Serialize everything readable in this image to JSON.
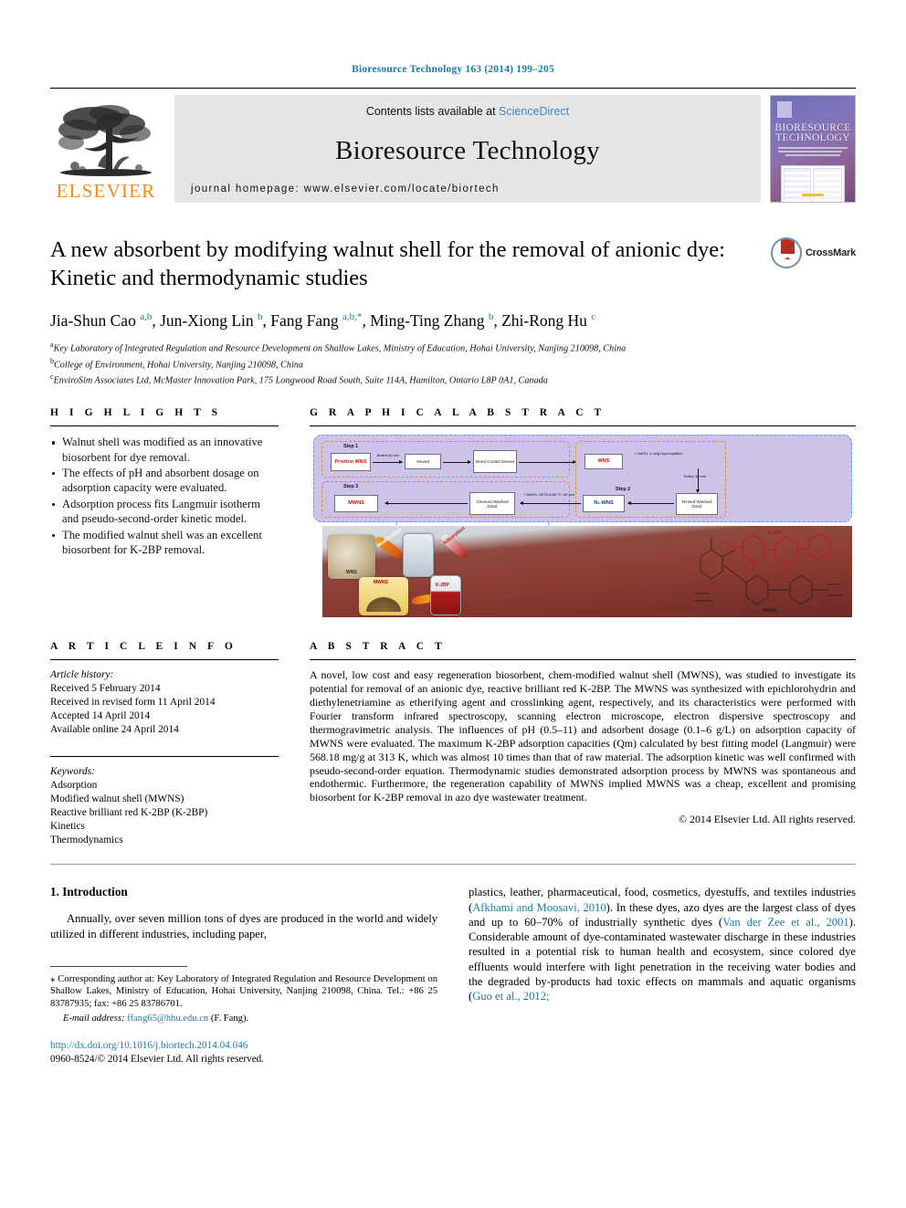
{
  "running_head": "Bioresource Technology 163 (2014) 199–205",
  "masthead": {
    "publisher": "ELSEVIER",
    "contents_prefix": "Contents lists available at ",
    "contents_link": "ScienceDirect",
    "journal_name": "Bioresource Technology",
    "homepage": "journal homepage: www.elsevier.com/locate/biortech",
    "cover_title_line1": "BIORESOURCE",
    "cover_title_line2": "TECHNOLOGY"
  },
  "article": {
    "title": "A new absorbent by modifying walnut shell for the removal of anionic dye: Kinetic and thermodynamic studies",
    "crossmark_label": "CrossMark",
    "authors": [
      {
        "name": "Jia-Shun Cao",
        "sup": "a,b"
      },
      {
        "name": "Jun-Xiong Lin",
        "sup": "b"
      },
      {
        "name": "Fang Fang",
        "sup": "a,b,*"
      },
      {
        "name": "Ming-Ting Zhang",
        "sup": "b"
      },
      {
        "name": "Zhi-Rong Hu",
        "sup": "c"
      }
    ],
    "affiliations": [
      {
        "marker": "a",
        "text": "Key Laboratory of Integrated Regulation and Resource Development on Shallow Lakes, Ministry of Education, Hohai University, Nanjing 210098, China"
      },
      {
        "marker": "b",
        "text": "College of Environment, Hohai University, Nanjing 210098, China"
      },
      {
        "marker": "c",
        "text": "EnviroSim Associates Ltd, McMaster Innovation Park, 175 Longwood Road South, Suite 114A, Hamilton, Ontario L8P 0A1, Canada"
      }
    ]
  },
  "highlights": {
    "label": "H I G H L I G H T S",
    "items": [
      "Walnut shell was modified as an innovative biosorbent for dye removal.",
      "The effects of pH and absorbent dosage on adsorption capacity were evaluated.",
      "Adsorption process fits Langmuir isotherm and pseudo-second-order kinetic model.",
      "The modified walnut shell was an excellent biosorbent for K-2BP removal."
    ]
  },
  "graphical_abstract": {
    "label": "G R A P H I C A L   A B S T R A C T",
    "flow": {
      "step1_label": "Step 1",
      "step2_label": "Step 2",
      "step3_label": "Step 3",
      "nodes": [
        {
          "id": "pristine",
          "text": "Pristine WNS",
          "style": "red"
        },
        {
          "id": "sieved",
          "text": "Sieved"
        },
        {
          "id": "dried1",
          "text": "Dried Cooled Sieved"
        },
        {
          "id": "wns",
          "text": "WNS",
          "style": "red"
        },
        {
          "id": "rinsed",
          "text": "Rinsed Washed Dried"
        },
        {
          "id": "n_wns",
          "text": "N₂-WNS",
          "style": "blue"
        },
        {
          "id": "cleaned",
          "text": "Cleaned Washed Dried"
        },
        {
          "id": "mwns",
          "text": "MWNS",
          "style": "red"
        }
      ],
      "annotations": [
        "Boiled 60 min",
        "+ NaOH, 4 ml/g Hydroxylation",
        "Reflux 30 min",
        "+ NaOH, DETA Δ 80 °C, 60 min"
      ]
    },
    "photo_labels": [
      "WNS",
      "MWNS",
      "K-2BP",
      "Modification",
      "Adsorption",
      "MWNS"
    ]
  },
  "article_info": {
    "label": "A R T I C L E   I N F O",
    "history_title": "Article history:",
    "history": [
      "Received 5 February 2014",
      "Received in revised form 11 April 2014",
      "Accepted 14 April 2014",
      "Available online 24 April 2014"
    ],
    "keywords_title": "Keywords:",
    "keywords": [
      "Adsorption",
      "Modified walnut shell (MWNS)",
      "Reactive brilliant red K-2BP (K-2BP)",
      "Kinetics",
      "Thermodynamics"
    ]
  },
  "abstract": {
    "label": "A B S T R A C T",
    "text": "A novel, low cost and easy regeneration biosorbent, chem-modified walnut shell (MWNS), was studied to investigate its potential for removal of an anionic dye, reactive brilliant red K-2BP. The MWNS was synthesized with epichlorohydrin and diethylenetriamine as etherifying agent and crosslinking agent, respectively, and its characteristics were performed with Fourier transform infrared spectroscopy, scanning electron microscope, electron dispersive spectroscopy and thermogravimetric analysis. The influences of pH (0.5–11) and adsorbent dosage (0.1–6 g/L) on adsorption capacity of MWNS were evaluated. The maximum K-2BP adsorption capacities (Qm) calculated by best fitting model (Langmuir) were 568.18 mg/g at 313 K, which was almost 10 times than that of raw material. The adsorption kinetic was well confirmed with pseudo-second-order equation. Thermodynamic studies demonstrated adsorption process by MWNS was spontaneous and endothermic. Furthermore, the regeneration capability of MWNS implied MWNS was a cheap, excellent and promising biosorbent for K-2BP removal in azo dye wastewater treatment.",
    "copyright": "© 2014 Elsevier Ltd. All rights reserved."
  },
  "body": {
    "section_heading": "1. Introduction",
    "left_paragraph": "Annually, over seven million tons of dyes are produced in the world and widely utilized in different industries, including paper,",
    "right_paragraph_1": "plastics, leather, pharmaceutical, food, cosmetics, dyestuffs, and textiles industries (",
    "right_cite_1": "Afkhami and Moosavi, 2010",
    "right_paragraph_2": "). In these dyes, azo dyes are the largest class of dyes and up to 60–70% of industrially synthetic dyes (",
    "right_cite_2": "Van der Zee et al., 2001",
    "right_paragraph_3": "). Considerable amount of dye-contaminated wastewater discharge in these industries resulted in a potential risk to human health and ecosystem, since colored dye effluents would interfere with light penetration in the receiving water bodies and the degraded by-products had toxic effects on mammals and aquatic organisms (",
    "right_cite_3": "Guo et al., 2012;"
  },
  "footer": {
    "corresponding_star": "⁎",
    "corresponding_text": "Corresponding author at: Key Laboratory of Integrated Regulation and Resource Development on Shallow Lakes, Ministry of Education, Hohai University, Nanjing 210098, China. Tel.: +86 25 83787935; fax: +86 25 83786701.",
    "email_label": "E-mail address:",
    "email": "ffang65@hhu.edu.cn",
    "email_owner": "(F. Fang).",
    "doi": "http://dx.doi.org/10.1016/j.biortech.2014.04.046",
    "issn_line": "0960-8524/© 2014 Elsevier Ltd. All rights reserved."
  }
}
